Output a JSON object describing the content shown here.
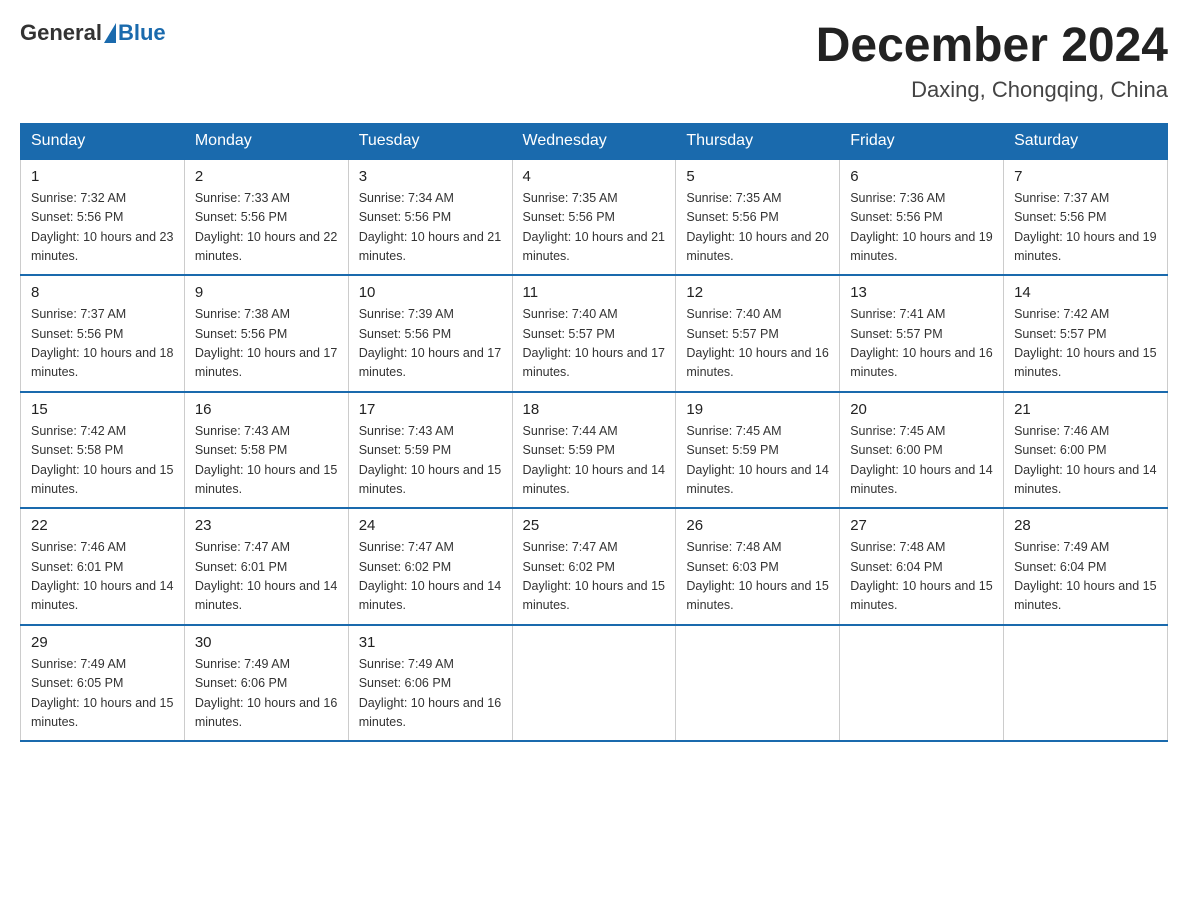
{
  "header": {
    "logo_general": "General",
    "logo_blue": "Blue",
    "month_title": "December 2024",
    "location": "Daxing, Chongqing, China"
  },
  "days_of_week": [
    "Sunday",
    "Monday",
    "Tuesday",
    "Wednesday",
    "Thursday",
    "Friday",
    "Saturday"
  ],
  "weeks": [
    [
      {
        "day": "1",
        "sunrise": "7:32 AM",
        "sunset": "5:56 PM",
        "daylight": "10 hours and 23 minutes."
      },
      {
        "day": "2",
        "sunrise": "7:33 AM",
        "sunset": "5:56 PM",
        "daylight": "10 hours and 22 minutes."
      },
      {
        "day": "3",
        "sunrise": "7:34 AM",
        "sunset": "5:56 PM",
        "daylight": "10 hours and 21 minutes."
      },
      {
        "day": "4",
        "sunrise": "7:35 AM",
        "sunset": "5:56 PM",
        "daylight": "10 hours and 21 minutes."
      },
      {
        "day": "5",
        "sunrise": "7:35 AM",
        "sunset": "5:56 PM",
        "daylight": "10 hours and 20 minutes."
      },
      {
        "day": "6",
        "sunrise": "7:36 AM",
        "sunset": "5:56 PM",
        "daylight": "10 hours and 19 minutes."
      },
      {
        "day": "7",
        "sunrise": "7:37 AM",
        "sunset": "5:56 PM",
        "daylight": "10 hours and 19 minutes."
      }
    ],
    [
      {
        "day": "8",
        "sunrise": "7:37 AM",
        "sunset": "5:56 PM",
        "daylight": "10 hours and 18 minutes."
      },
      {
        "day": "9",
        "sunrise": "7:38 AM",
        "sunset": "5:56 PM",
        "daylight": "10 hours and 17 minutes."
      },
      {
        "day": "10",
        "sunrise": "7:39 AM",
        "sunset": "5:56 PM",
        "daylight": "10 hours and 17 minutes."
      },
      {
        "day": "11",
        "sunrise": "7:40 AM",
        "sunset": "5:57 PM",
        "daylight": "10 hours and 17 minutes."
      },
      {
        "day": "12",
        "sunrise": "7:40 AM",
        "sunset": "5:57 PM",
        "daylight": "10 hours and 16 minutes."
      },
      {
        "day": "13",
        "sunrise": "7:41 AM",
        "sunset": "5:57 PM",
        "daylight": "10 hours and 16 minutes."
      },
      {
        "day": "14",
        "sunrise": "7:42 AM",
        "sunset": "5:57 PM",
        "daylight": "10 hours and 15 minutes."
      }
    ],
    [
      {
        "day": "15",
        "sunrise": "7:42 AM",
        "sunset": "5:58 PM",
        "daylight": "10 hours and 15 minutes."
      },
      {
        "day": "16",
        "sunrise": "7:43 AM",
        "sunset": "5:58 PM",
        "daylight": "10 hours and 15 minutes."
      },
      {
        "day": "17",
        "sunrise": "7:43 AM",
        "sunset": "5:59 PM",
        "daylight": "10 hours and 15 minutes."
      },
      {
        "day": "18",
        "sunrise": "7:44 AM",
        "sunset": "5:59 PM",
        "daylight": "10 hours and 14 minutes."
      },
      {
        "day": "19",
        "sunrise": "7:45 AM",
        "sunset": "5:59 PM",
        "daylight": "10 hours and 14 minutes."
      },
      {
        "day": "20",
        "sunrise": "7:45 AM",
        "sunset": "6:00 PM",
        "daylight": "10 hours and 14 minutes."
      },
      {
        "day": "21",
        "sunrise": "7:46 AM",
        "sunset": "6:00 PM",
        "daylight": "10 hours and 14 minutes."
      }
    ],
    [
      {
        "day": "22",
        "sunrise": "7:46 AM",
        "sunset": "6:01 PM",
        "daylight": "10 hours and 14 minutes."
      },
      {
        "day": "23",
        "sunrise": "7:47 AM",
        "sunset": "6:01 PM",
        "daylight": "10 hours and 14 minutes."
      },
      {
        "day": "24",
        "sunrise": "7:47 AM",
        "sunset": "6:02 PM",
        "daylight": "10 hours and 14 minutes."
      },
      {
        "day": "25",
        "sunrise": "7:47 AM",
        "sunset": "6:02 PM",
        "daylight": "10 hours and 15 minutes."
      },
      {
        "day": "26",
        "sunrise": "7:48 AM",
        "sunset": "6:03 PM",
        "daylight": "10 hours and 15 minutes."
      },
      {
        "day": "27",
        "sunrise": "7:48 AM",
        "sunset": "6:04 PM",
        "daylight": "10 hours and 15 minutes."
      },
      {
        "day": "28",
        "sunrise": "7:49 AM",
        "sunset": "6:04 PM",
        "daylight": "10 hours and 15 minutes."
      }
    ],
    [
      {
        "day": "29",
        "sunrise": "7:49 AM",
        "sunset": "6:05 PM",
        "daylight": "10 hours and 15 minutes."
      },
      {
        "day": "30",
        "sunrise": "7:49 AM",
        "sunset": "6:06 PM",
        "daylight": "10 hours and 16 minutes."
      },
      {
        "day": "31",
        "sunrise": "7:49 AM",
        "sunset": "6:06 PM",
        "daylight": "10 hours and 16 minutes."
      },
      null,
      null,
      null,
      null
    ]
  ]
}
